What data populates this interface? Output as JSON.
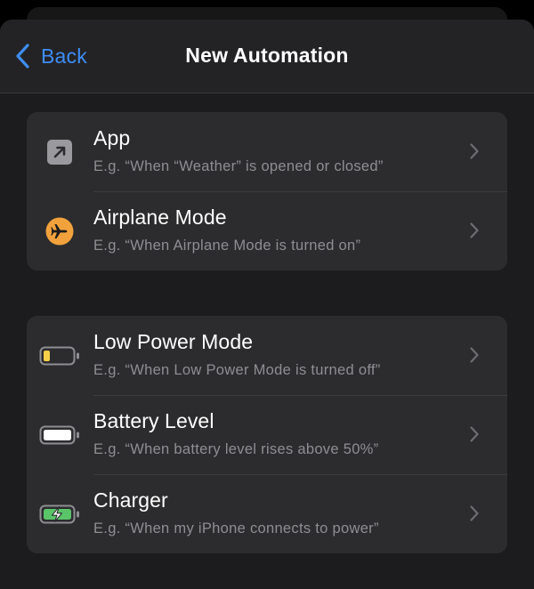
{
  "navbar": {
    "back_label": "Back",
    "title": "New Automation"
  },
  "groups": [
    {
      "items": [
        {
          "title": "App",
          "subtitle": "E.g. “When “Weather” is opened or closed”",
          "icon": "app-open-icon"
        },
        {
          "title": "Airplane Mode",
          "subtitle": "E.g. “When Airplane Mode is turned on”",
          "icon": "airplane-icon"
        }
      ]
    },
    {
      "items": [
        {
          "title": "Low Power Mode",
          "subtitle": "E.g. “When Low Power Mode is turned off”",
          "icon": "battery-low-icon"
        },
        {
          "title": "Battery Level",
          "subtitle": "E.g. “When battery level rises above 50%”",
          "icon": "battery-full-icon"
        },
        {
          "title": "Charger",
          "subtitle": "E.g. “When my iPhone connects to power”",
          "icon": "battery-charging-icon"
        }
      ]
    }
  ],
  "colors": {
    "accent": "#3e8ef7",
    "airplane_orange": "#f2a23c",
    "low_power_yellow": "#f5cf48",
    "charging_green": "#5ac469",
    "app_icon_gray": "#9a9a9e"
  }
}
